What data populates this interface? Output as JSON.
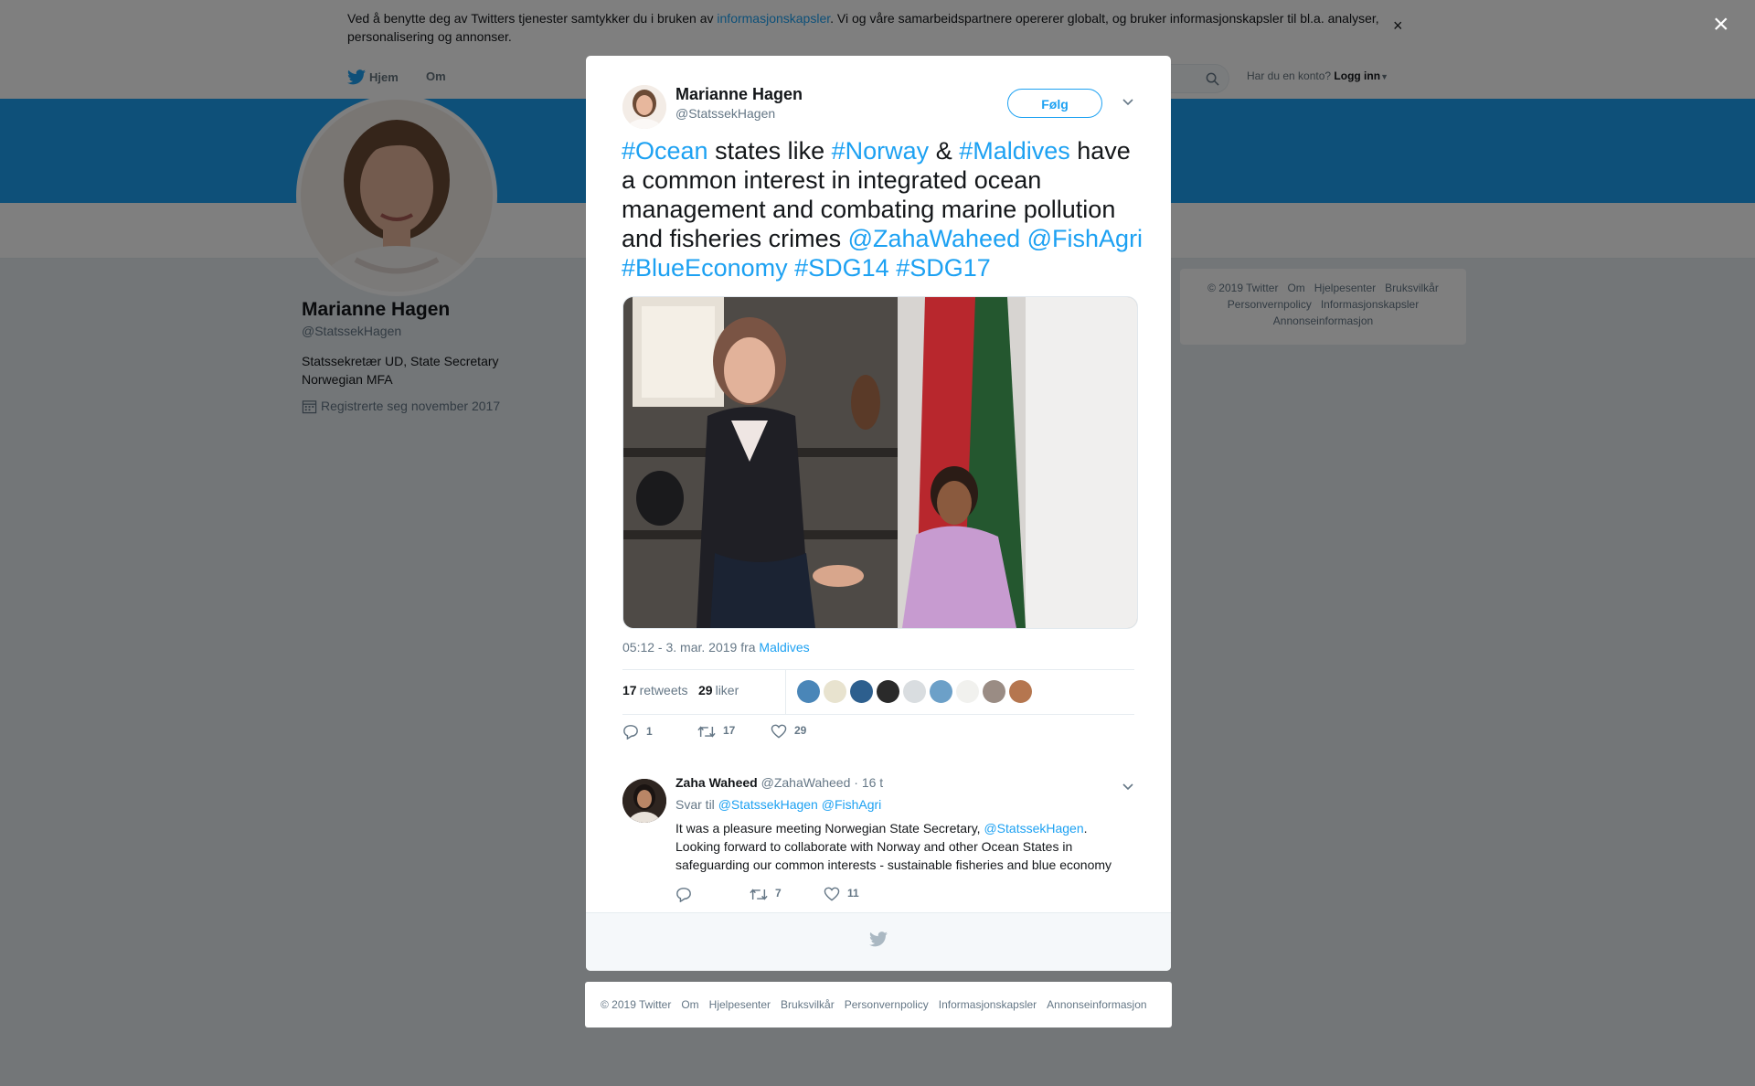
{
  "cookie_banner": {
    "text_before": "Ved å benytte deg av Twitters tjenester samtykker du i bruken av ",
    "link": "informasjonskapsler",
    "text_after": ". Vi og våre samarbeidspartnere opererer globalt, og bruker informasjonskapsler til bl.a. analyser, personalisering og annonser.",
    "close": "×"
  },
  "nav": {
    "home": "Hjem",
    "about": "Om",
    "have_account": "Har du en konto?",
    "login": "Logg inn"
  },
  "profile": {
    "name": "Marianne Hagen",
    "handle": "@StatssekHagen",
    "bio": "Statssekretær UD, State Secretary Norwegian MFA",
    "joined": "Registrerte seg november 2017"
  },
  "side_footer": {
    "line1": [
      "© 2019 Twitter",
      "Om",
      "Hjelpesenter",
      "Bruksvilkår"
    ],
    "line2": [
      "Personvernpolicy",
      "Informasjonskapsler"
    ],
    "line3": [
      "Annonseinformasjon"
    ]
  },
  "overlay": {
    "close": "×"
  },
  "tweet": {
    "author_name": "Marianne Hagen",
    "author_handle": "@StatssekHagen",
    "follow": "Følg",
    "text": {
      "h_ocean": "#Ocean",
      "t1": " states like ",
      "h_norway": "#Norway",
      "t2": " & ",
      "h_maldives": "#Maldives",
      "t3": " have a common interest in integrated ocean management and combating marine pollution and fisheries crimes ",
      "m_zaha": "@ZahaWaheed",
      "m_fish": "@FishAgri",
      "h_blue": "#BlueEconomy",
      "h_sdg14": "#SDG14",
      "h_sdg17": "#SDG17"
    },
    "time": "05:12 - 3. mar. 2019 fra ",
    "location": "Maldives",
    "retweets_count": "17",
    "retweets_label": "retweets",
    "likes_count": "29",
    "likes_label": "liker",
    "actions": {
      "replies": "1",
      "retweets": "17",
      "likes": "29"
    }
  },
  "reply": {
    "name": "Zaha Waheed",
    "handle": "@ZahaWaheed",
    "time": "· 16 t",
    "reply_to_label": "Svar til ",
    "reply_to_1": "@StatssekHagen",
    "reply_to_2": "@FishAgri",
    "text_1": "It was a pleasure meeting Norwegian State Secretary, ",
    "mention": "@StatssekHagen",
    "text_2": ". Looking forward to collaborate with Norway and other Ocean States  in safeguarding our common interests - sustainable fisheries and blue economy",
    "actions": {
      "replies": "",
      "retweets": "7",
      "likes": "11"
    }
  },
  "modal_footer": [
    "© 2019 Twitter",
    "Om",
    "Hjelpesenter",
    "Bruksvilkår",
    "Personvernpolicy",
    "Informasjonskapsler",
    "Annonseinformasjon"
  ],
  "colors": {
    "accent": "#1da1f2",
    "text": "#14171a",
    "muted": "#657786",
    "banner": "#1da1f2"
  },
  "icons": [
    "twitter-bird-icon",
    "search-icon",
    "close-icon",
    "chevron-down-icon",
    "calendar-icon",
    "reply-icon",
    "retweet-icon",
    "heart-icon"
  ]
}
